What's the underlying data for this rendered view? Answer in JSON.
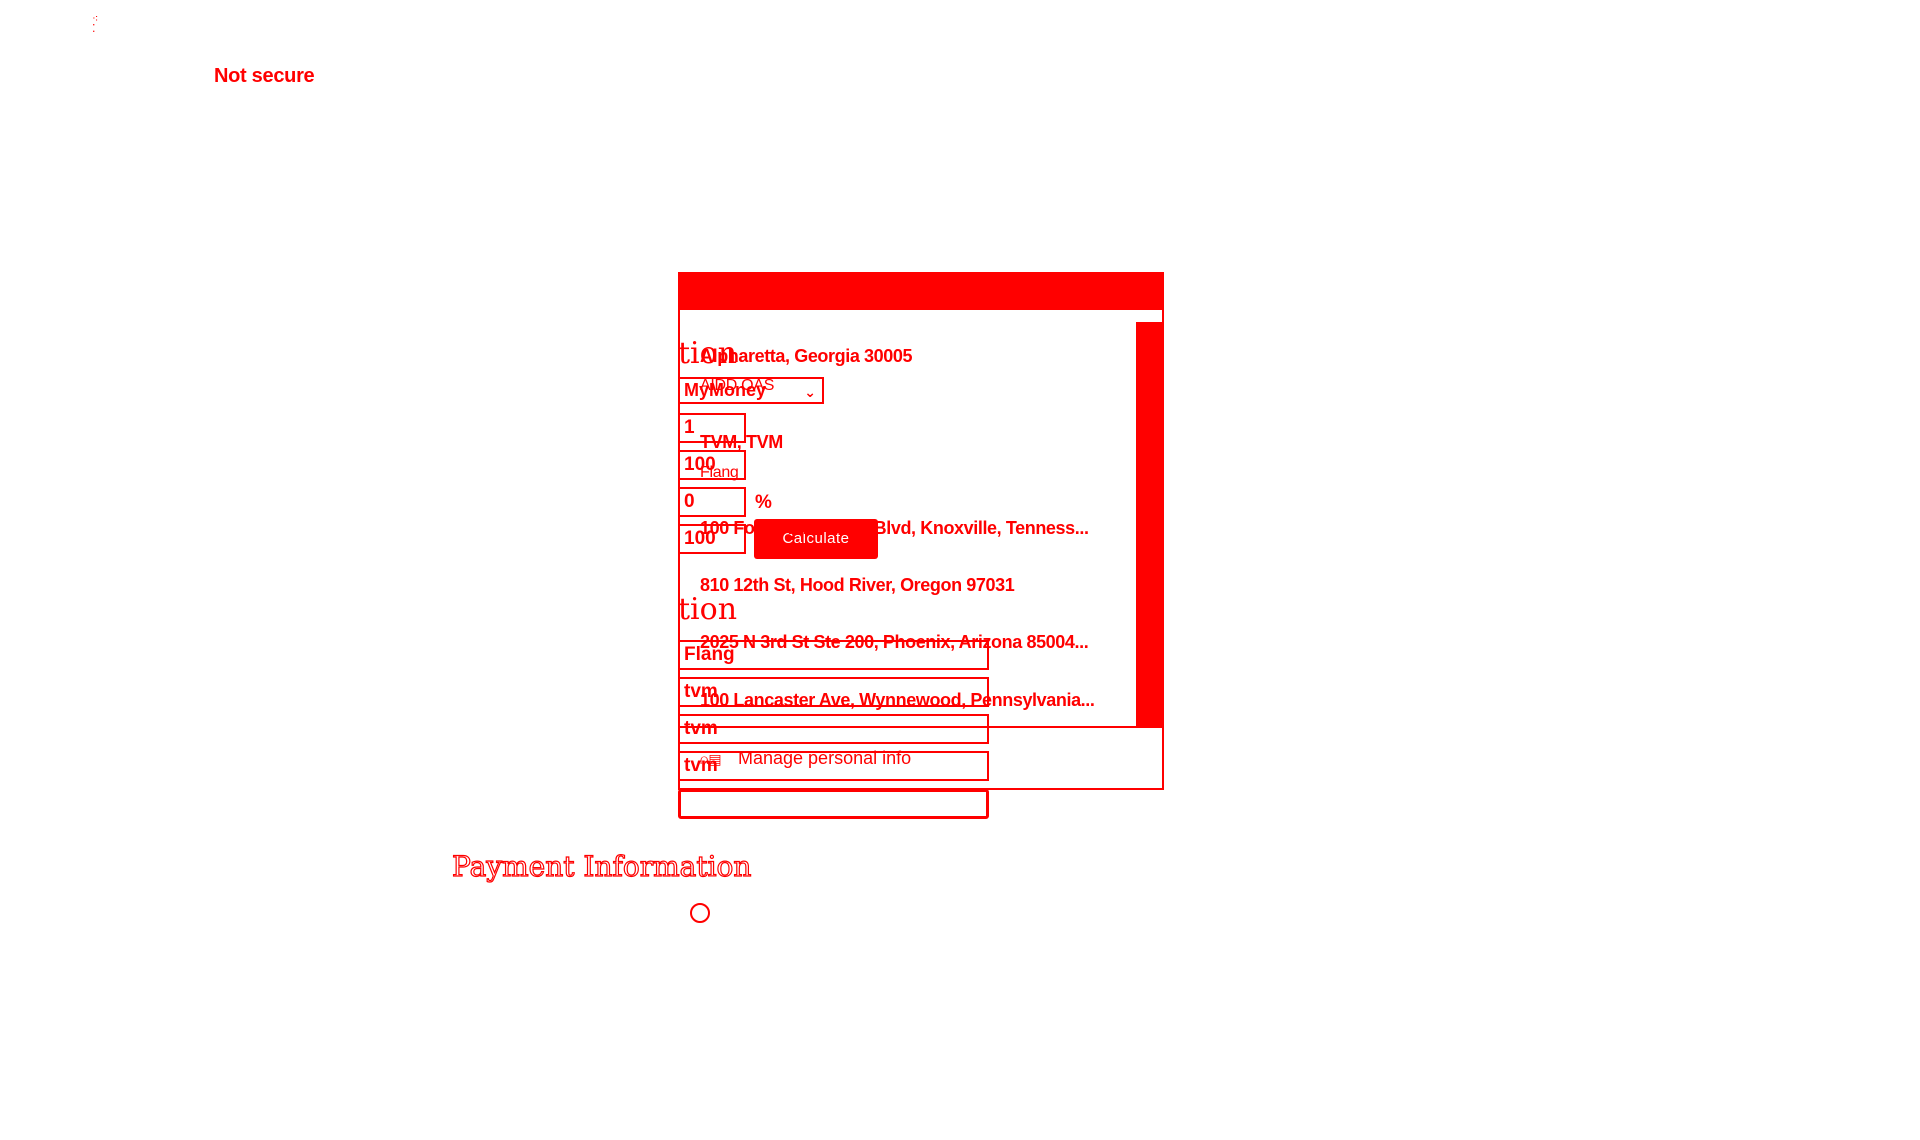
{
  "browser": {
    "security_label": "Not secure"
  },
  "form": {
    "heading_fragment_1": "tion",
    "heading_fragment_2": "tion",
    "bank_select_value": "MyMoney",
    "inputs": {
      "field_1": "1",
      "field_2": "100",
      "field_3": "0",
      "field_4": "100"
    },
    "percent_sign": "%",
    "calculate_label": "Calculate",
    "text_fields": [
      "Flang",
      "tvm",
      "tvm",
      "tvm",
      ""
    ],
    "payment_heading": "Payment Information"
  },
  "autofill_popup": {
    "addresses": [
      {
        "street": "Alpharetta, Georgia 30005",
        "sub": "AIDD OAS"
      },
      {
        "street": "TVM, TVM",
        "sub": "Flang"
      },
      {
        "street": "100 Fox Knoll Forest Blvd, Knoxville, Tenness...",
        "sub": ""
      },
      {
        "street": "810 12th St, Hood River, Oregon 97031",
        "sub": ""
      },
      {
        "street": "2025 N 3rd St Ste 200, Phoenix, Arizona 85004...",
        "sub": ""
      },
      {
        "street": "100 Lancaster Ave, Wynnewood, Pennsylvania...",
        "sub": ""
      }
    ],
    "manage_label": "Manage personal info",
    "manage_icon": "person-card-icon"
  },
  "colors": {
    "accent": "#ff0000",
    "background": "#ffffff"
  }
}
